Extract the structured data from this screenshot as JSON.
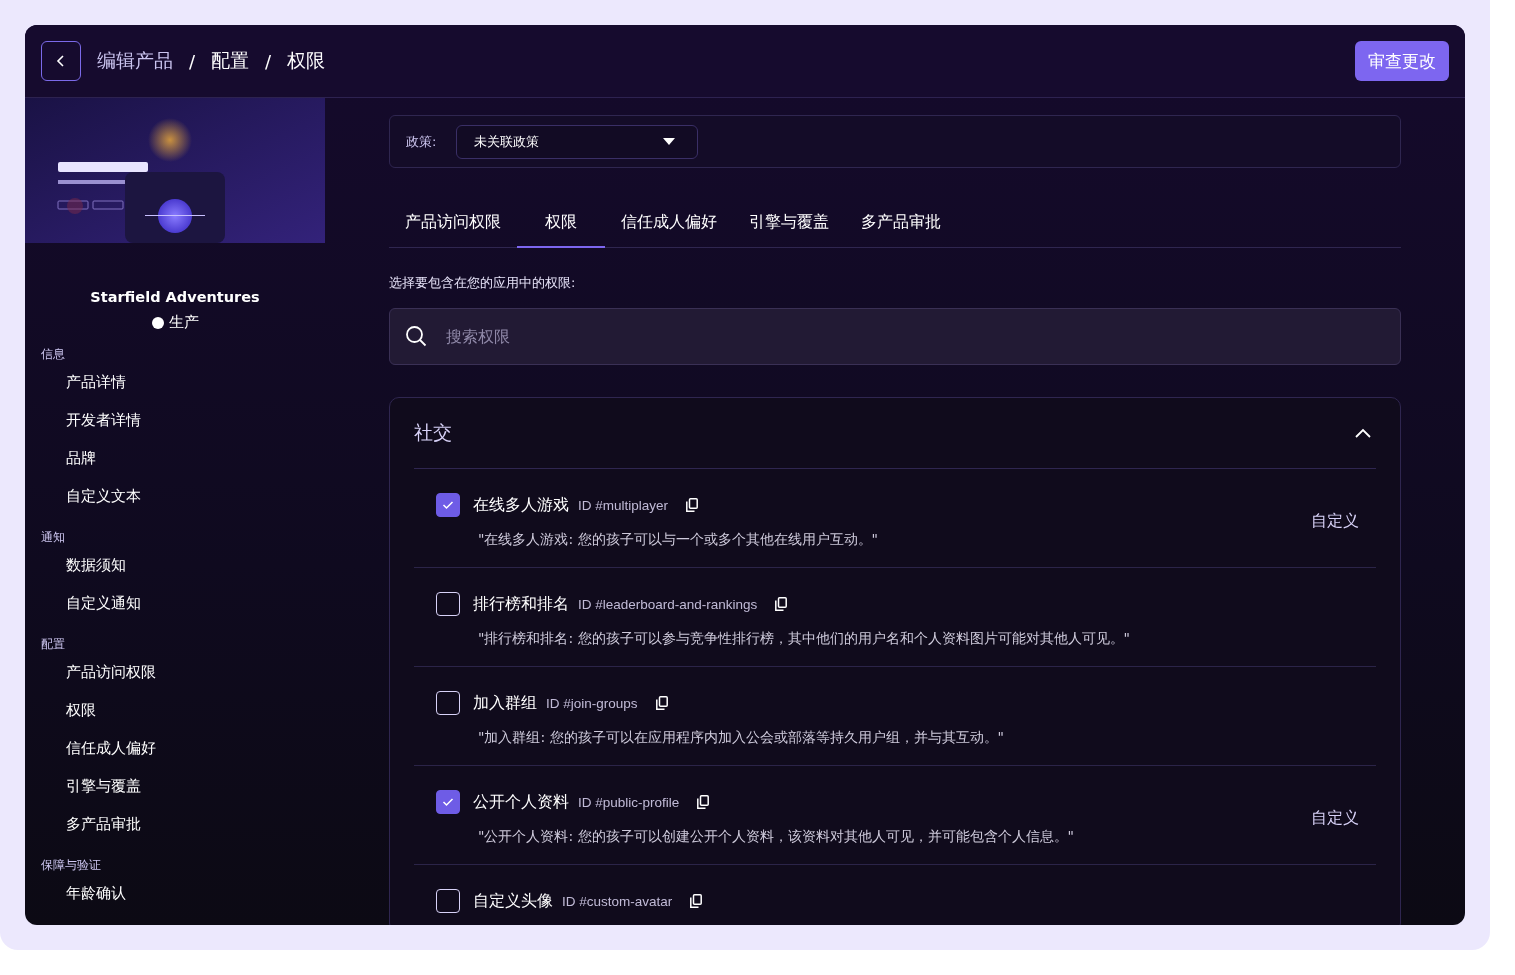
{
  "header": {
    "breadcrumb": [
      "编辑产品",
      "配置",
      "权限"
    ],
    "separator": "/",
    "review_button": "审查更改"
  },
  "sidebar": {
    "product_name": "Starfield Adventures",
    "status": "生产",
    "sections": [
      {
        "title": "信息",
        "items": [
          "产品详情",
          "开发者详情",
          "品牌",
          "自定义文本"
        ]
      },
      {
        "title": "通知",
        "items": [
          "数据须知",
          "自定义通知"
        ]
      },
      {
        "title": "配置",
        "items": [
          "产品访问权限",
          "权限",
          "信任成人偏好",
          "引擎与覆盖",
          "多产品审批"
        ]
      },
      {
        "title": "保障与验证",
        "items": [
          "年龄确认"
        ]
      }
    ]
  },
  "policy": {
    "label": "政策:",
    "value": "未关联政策"
  },
  "tabs": [
    {
      "label": "产品访问权限",
      "selected": false
    },
    {
      "label": "权限",
      "selected": true
    },
    {
      "label": "信任成人偏好",
      "selected": false
    },
    {
      "label": "引擎与覆盖",
      "selected": false
    },
    {
      "label": "多产品审批",
      "selected": false
    }
  ],
  "instruction": "选择要包含在您的应用中的权限:",
  "search": {
    "placeholder": "搜索权限"
  },
  "group": {
    "title": "社交",
    "expanded": true,
    "permissions": [
      {
        "checked": true,
        "title": "在线多人游戏",
        "id": "ID #multiplayer",
        "description": "\"在线多人游戏: 您的孩子可以与一个或多个其他在线用户互动。\"",
        "action": "自定义"
      },
      {
        "checked": false,
        "title": "排行榜和排名",
        "id": "ID #leaderboard-and-rankings",
        "description": "\"排行榜和排名: 您的孩子可以参与竞争性排行榜，其中他们的用户名和个人资料图片可能对其他人可见。\""
      },
      {
        "checked": false,
        "title": "加入群组",
        "id": "ID #join-groups",
        "description": "\"加入群组: 您的孩子可以在应用程序内加入公会或部落等持久用户组，并与其互动。\""
      },
      {
        "checked": true,
        "title": "公开个人资料",
        "id": "ID #public-profile",
        "description": "\"公开个人资料: 您的孩子可以创建公开个人资料，该资料对其他人可见，并可能包含个人信息。\"",
        "action": "自定义"
      },
      {
        "checked": false,
        "title": "自定义头像",
        "id": "ID #custom-avatar"
      }
    ]
  }
}
